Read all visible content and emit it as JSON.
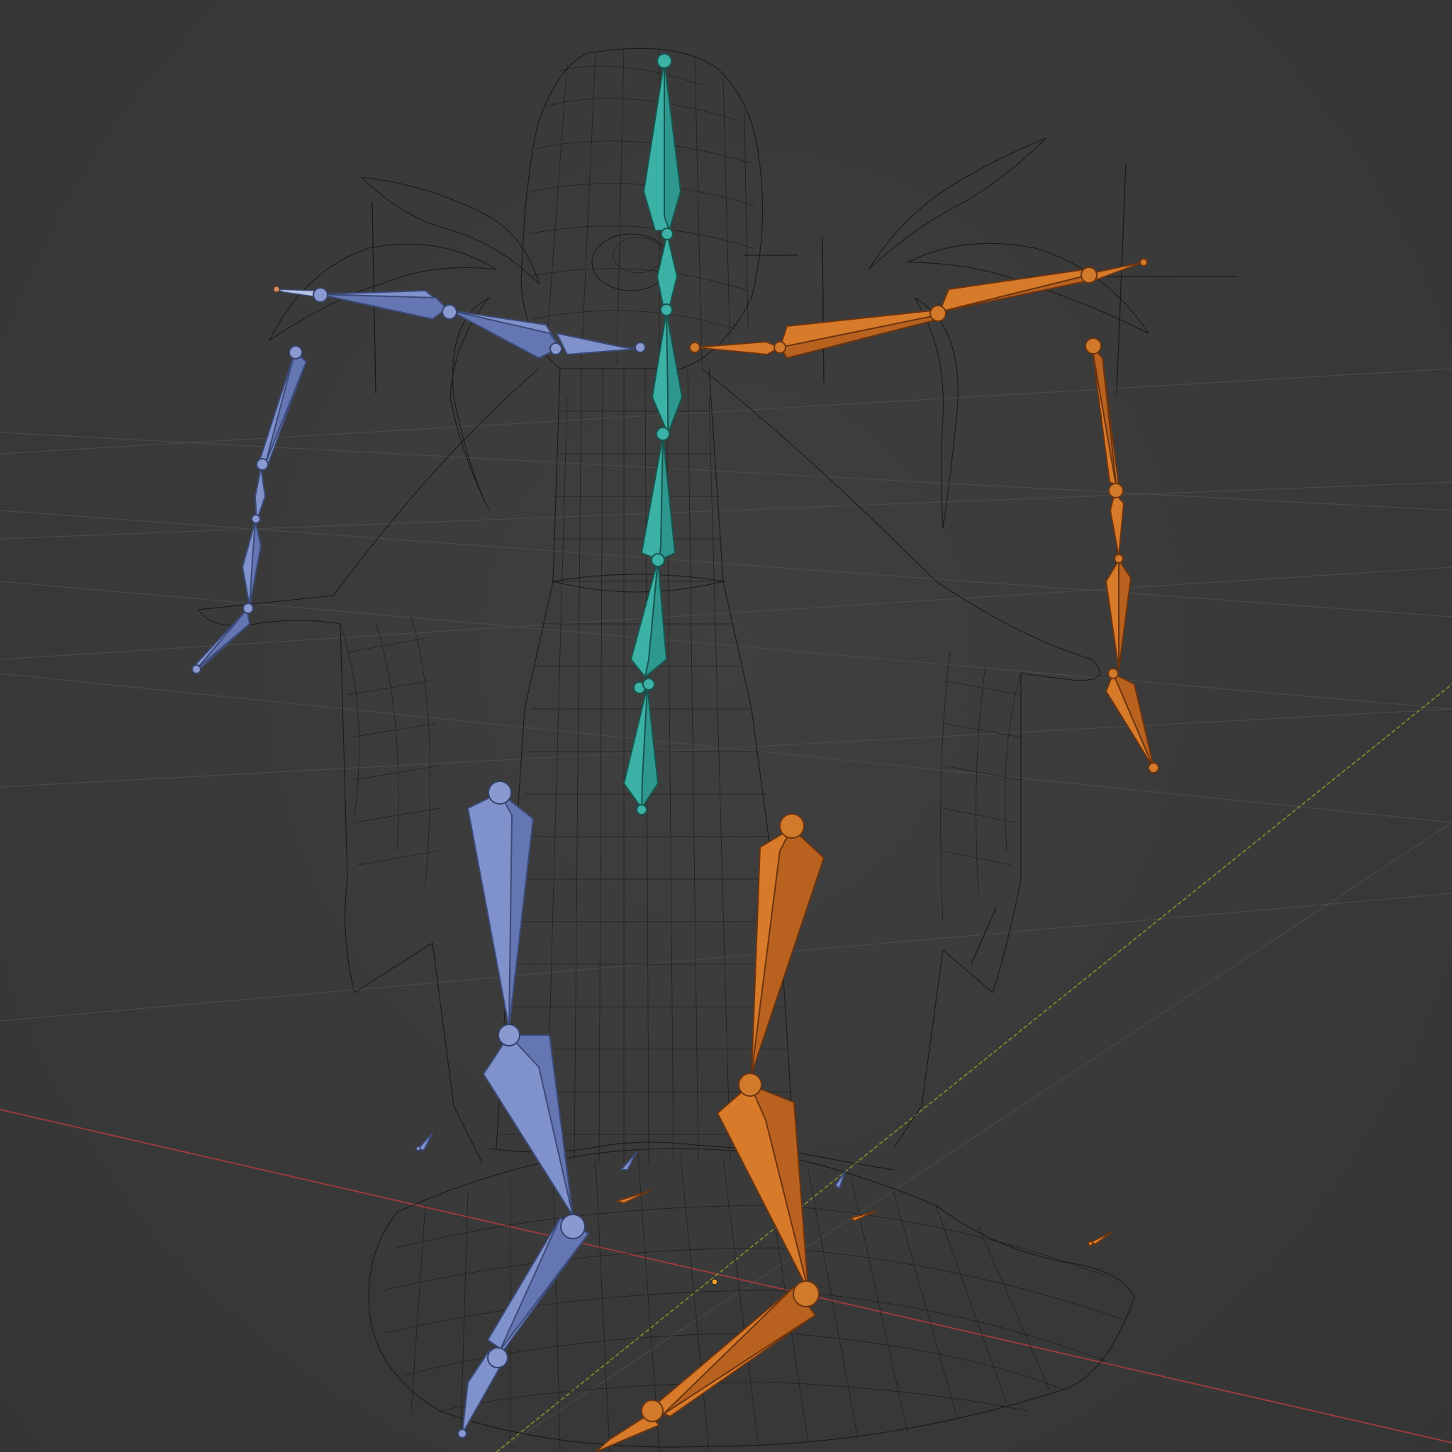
{
  "viewport": {
    "background_color": "#3a3a3a",
    "grid_color": "#4a4a4a",
    "x_axis_color": "#a33b3b",
    "y_axis_color": "#7a8a2a"
  },
  "mesh": {
    "display": "wireframe",
    "wire_color": "#141414"
  },
  "armature": {
    "left_side_color": "#8092cb",
    "right_side_color": "#d77a2a",
    "center_color": "#3cb1a6",
    "bone_display": "octahedral"
  },
  "icons": {
    "origin": "origin-dot-icon",
    "empty_cross": "empty-cross-icon"
  }
}
